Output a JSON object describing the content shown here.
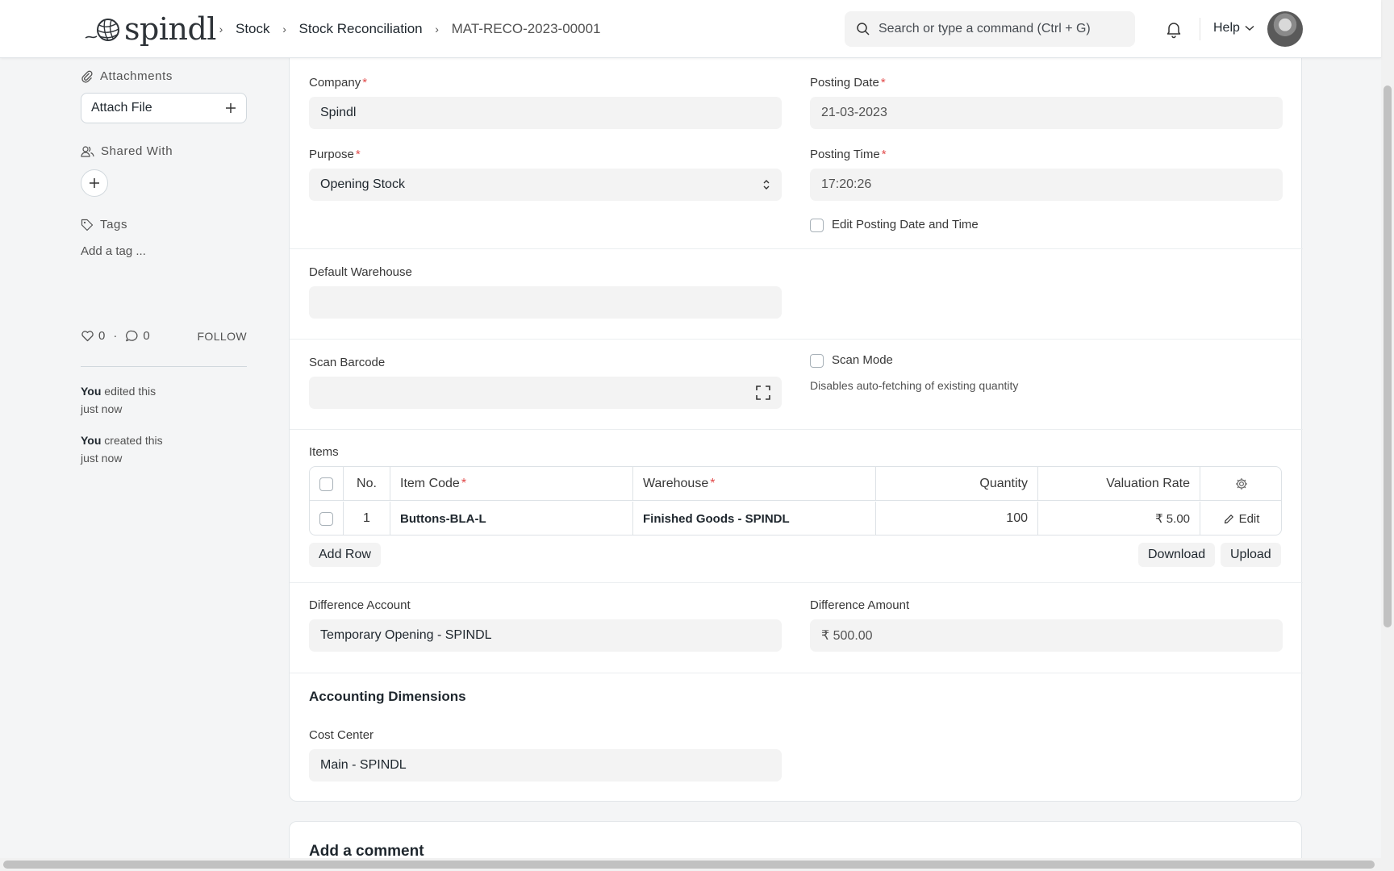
{
  "app": {
    "logo_text": "spindl"
  },
  "breadcrumbs": [
    "Stock",
    "Stock Reconciliation",
    "MAT-RECO-2023-00001"
  ],
  "search": {
    "placeholder": "Search or type a command (Ctrl + G)"
  },
  "help_label": "Help",
  "sidebar": {
    "attachments_label": "Attachments",
    "attach_file_label": "Attach File",
    "shared_with_label": "Shared With",
    "tags_label": "Tags",
    "add_tag_label": "Add a tag ...",
    "likes_count": "0",
    "comments_count": "0",
    "follow_label": "FOLLOW",
    "activity": [
      {
        "who": "You",
        "action": " edited this",
        "when": "just now"
      },
      {
        "who": "You",
        "action": " created this",
        "when": "just now"
      }
    ]
  },
  "form": {
    "company": {
      "label": "Company",
      "value": "Spindl"
    },
    "posting_date": {
      "label": "Posting Date",
      "value": "21-03-2023"
    },
    "purpose": {
      "label": "Purpose",
      "value": "Opening Stock"
    },
    "posting_time": {
      "label": "Posting Time",
      "value": "17:20:26"
    },
    "edit_posting_label": "Edit Posting Date and Time",
    "default_warehouse": {
      "label": "Default Warehouse",
      "value": ""
    },
    "scan_barcode": {
      "label": "Scan Barcode",
      "value": ""
    },
    "scan_mode": {
      "label": "Scan Mode",
      "help": "Disables auto-fetching of existing quantity"
    },
    "items_label": "Items",
    "items_table": {
      "columns": [
        "No.",
        "Item Code",
        "Warehouse",
        "Quantity",
        "Valuation Rate"
      ],
      "rows": [
        {
          "no": "1",
          "item_code": "Buttons-BLA-L",
          "warehouse": "Finished Goods - SPINDL",
          "quantity": "100",
          "valuation_rate": "₹ 5.00",
          "edit_label": "Edit"
        }
      ]
    },
    "add_row_label": "Add Row",
    "download_label": "Download",
    "upload_label": "Upload",
    "difference_account": {
      "label": "Difference Account",
      "value": "Temporary Opening - SPINDL"
    },
    "difference_amount": {
      "label": "Difference Amount",
      "value": "₹ 500.00"
    },
    "accounting_dimensions_title": "Accounting Dimensions",
    "cost_center": {
      "label": "Cost Center",
      "value": "Main - SPINDL"
    }
  },
  "comment_title": "Add a comment"
}
